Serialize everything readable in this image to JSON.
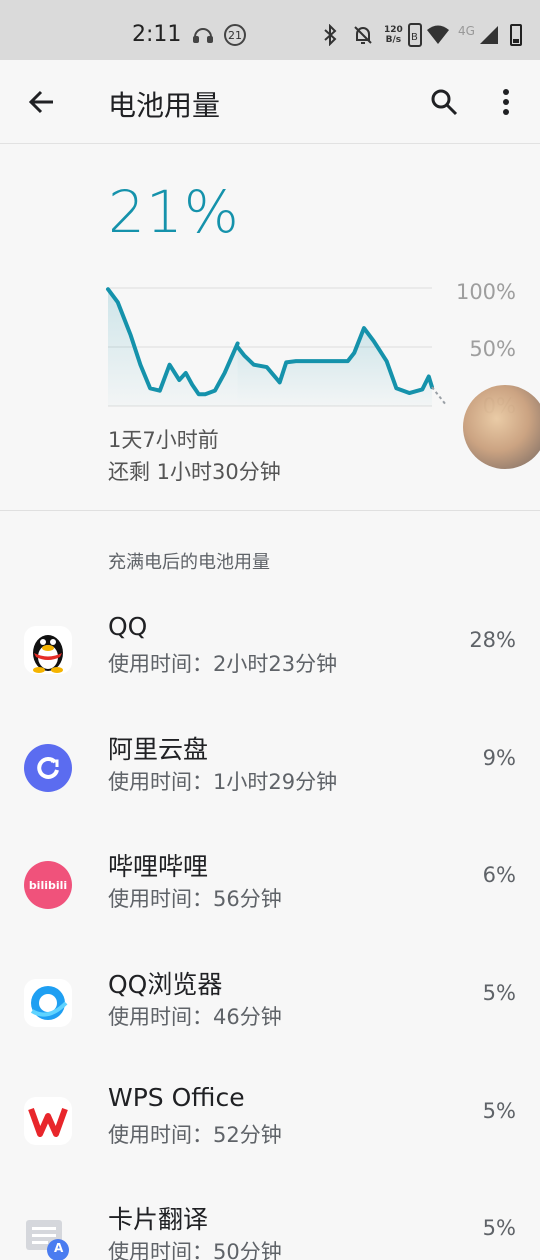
{
  "status_bar": {
    "time": "2:11",
    "notification_badge": "21",
    "net_speed_top": "120",
    "net_speed_bottom": "B/s",
    "network_type": "4G",
    "icons": [
      "headset-icon",
      "badge-21-icon",
      "bluetooth-icon",
      "silent-icon",
      "netspeed-icon",
      "wifi-icon",
      "signal-icon",
      "battery-icon"
    ]
  },
  "app_bar": {
    "title": "电池用量",
    "icons": [
      "back-arrow-icon",
      "search-icon",
      "more-vert-icon"
    ]
  },
  "battery": {
    "level": "21%",
    "since": "1天7小时前",
    "remaining": "还剩 1小时30分钟",
    "accent_color": "#1592ab"
  },
  "chart_data": {
    "type": "line",
    "y_tick_labels": [
      "100%",
      "50%",
      "0%"
    ],
    "ylim": [
      0,
      100
    ],
    "series": [
      {
        "x": [
          0,
          3,
          7,
          10,
          13,
          16,
          19,
          22,
          24,
          26,
          28,
          30,
          33,
          36,
          40
        ],
        "y": [
          99,
          88,
          60,
          35,
          15,
          13,
          35,
          22,
          28,
          18,
          10,
          10,
          13,
          28,
          53
        ]
      },
      {
        "x": [
          40,
          42,
          45,
          49,
          53,
          55,
          58,
          66,
          74,
          76,
          79,
          82,
          86,
          89,
          93,
          97,
          99,
          100
        ],
        "y": [
          50,
          43,
          35,
          33,
          20,
          37,
          38,
          38,
          38,
          45,
          66,
          55,
          38,
          15,
          11,
          14,
          25,
          16
        ]
      }
    ],
    "projection": {
      "x": [
        100,
        104
      ],
      "y": [
        16,
        2
      ]
    },
    "grid": true
  },
  "section_header": "充满电后的电池用量",
  "apps": [
    {
      "name": "QQ",
      "usage": "使用时间：2小时23分钟",
      "percent": "28%",
      "icon": "qq-penguin-icon"
    },
    {
      "name": "阿里云盘",
      "usage": "使用时间：1小时29分钟",
      "percent": "9%",
      "icon": "aliyun-drive-icon"
    },
    {
      "name": "哔哩哔哩",
      "usage": "使用时间：56分钟",
      "percent": "6%",
      "icon": "bilibili-icon",
      "icon_text": "bilibili"
    },
    {
      "name": "QQ浏览器",
      "usage": "使用时间：46分钟",
      "percent": "5%",
      "icon": "qq-browser-icon"
    },
    {
      "name": "WPS Office",
      "usage": "使用时间：52分钟",
      "percent": "5%",
      "icon": "wps-office-icon"
    },
    {
      "name": "卡片翻译",
      "usage": "使用时间：50分钟",
      "percent": "5%",
      "icon": "card-translate-icon",
      "icon_text": "A"
    }
  ]
}
